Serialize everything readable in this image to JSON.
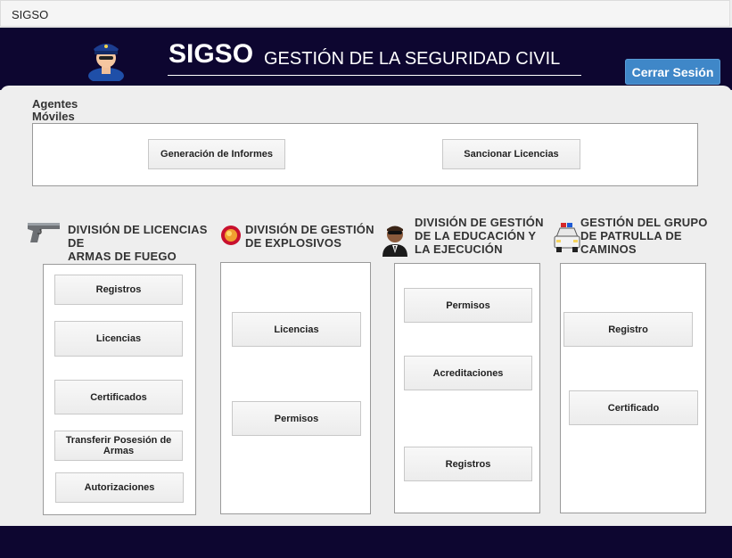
{
  "window": {
    "title": "SIGSO"
  },
  "header": {
    "brand": "SIGSO",
    "subtitle": "GESTIÓN DE LA SEGURIDAD CIVIL",
    "logout_label": "Cerrar Sesión",
    "background": "#0d0630",
    "accent": "#3f87c8"
  },
  "mobile_agents": {
    "label_line1": "Agentes",
    "label_line2": "Móviles",
    "buttons": [
      "Generación de Informes",
      "Sancionar Licencias"
    ]
  },
  "divisions": [
    {
      "icon": "pistol-icon",
      "title_lines": [
        "DIVISIÓN DE LICENCIAS",
        "DE",
        "ARMAS DE FUEGO"
      ],
      "buttons": [
        "Registros",
        "Licencias",
        "Certificados",
        "Transferir Posesión de Armas",
        "Autorizaciones"
      ]
    },
    {
      "icon": "explosive-icon",
      "title_lines": [
        "DIVISIÓN DE GESTIÓN",
        "DE EXPLOSIVOS"
      ],
      "buttons": [
        "Licencias",
        "Permisos"
      ]
    },
    {
      "icon": "agent-icon",
      "title_lines": [
        "DIVISIÓN DE GESTIÓN",
        "DE LA EDUCACIÓN Y",
        "LA EJECUCIÓN"
      ],
      "buttons": [
        "Permisos",
        "Acreditaciones",
        "Registros"
      ]
    },
    {
      "icon": "patrol-car-icon",
      "title_lines": [
        "GESTIÓN DEL GRUPO",
        "DE PATRULLA DE",
        "CAMINOS"
      ],
      "buttons": [
        "Registro",
        "Certificado"
      ]
    }
  ]
}
